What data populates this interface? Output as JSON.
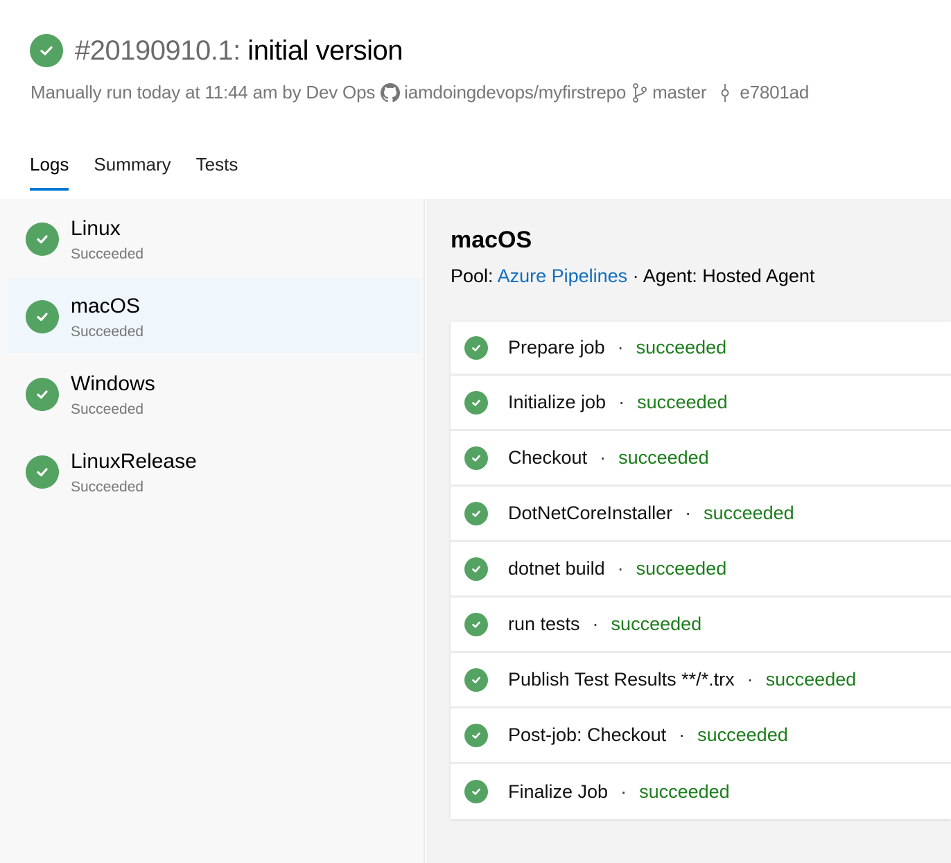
{
  "header": {
    "run_number": "#20190910.1:",
    "run_message": " initial version",
    "status": "succeeded",
    "meta": {
      "trigger_text": "Manually run today at 11:44 am by Dev Ops",
      "repo": "iamdoingdevops/myfirstrepo",
      "branch": "master",
      "commit": "e7801ad"
    }
  },
  "tabs": [
    {
      "label": "Logs",
      "active": true
    },
    {
      "label": "Summary",
      "active": false
    },
    {
      "label": "Tests",
      "active": false
    }
  ],
  "jobs": [
    {
      "name": "Linux",
      "status": "Succeeded",
      "selected": false
    },
    {
      "name": "macOS",
      "status": "Succeeded",
      "selected": true
    },
    {
      "name": "Windows",
      "status": "Succeeded",
      "selected": false
    },
    {
      "name": "LinuxRelease",
      "status": "Succeeded",
      "selected": false
    }
  ],
  "detail": {
    "title": "macOS",
    "pool_label": "Pool: ",
    "pool_name": "Azure Pipelines",
    "separator": " · ",
    "agent_text": "Agent: Hosted Agent",
    "steps": [
      {
        "name": "Prepare job",
        "status": "succeeded"
      },
      {
        "name": "Initialize job",
        "status": "succeeded"
      },
      {
        "name": "Checkout",
        "status": "succeeded"
      },
      {
        "name": "DotNetCoreInstaller",
        "status": "succeeded"
      },
      {
        "name": "dotnet build",
        "status": "succeeded"
      },
      {
        "name": "run tests",
        "status": "succeeded"
      },
      {
        "name": "Publish Test Results **/*.trx",
        "status": "succeeded"
      },
      {
        "name": "Post-job: Checkout",
        "status": "succeeded"
      },
      {
        "name": "Finalize Job",
        "status": "succeeded"
      }
    ],
    "step_dot": "·"
  },
  "colors": {
    "success": "#55a362",
    "success_text": "#1b7d1b",
    "accent": "#0078d4",
    "link": "#106ebe",
    "selected_bg": "#eff6fc"
  }
}
